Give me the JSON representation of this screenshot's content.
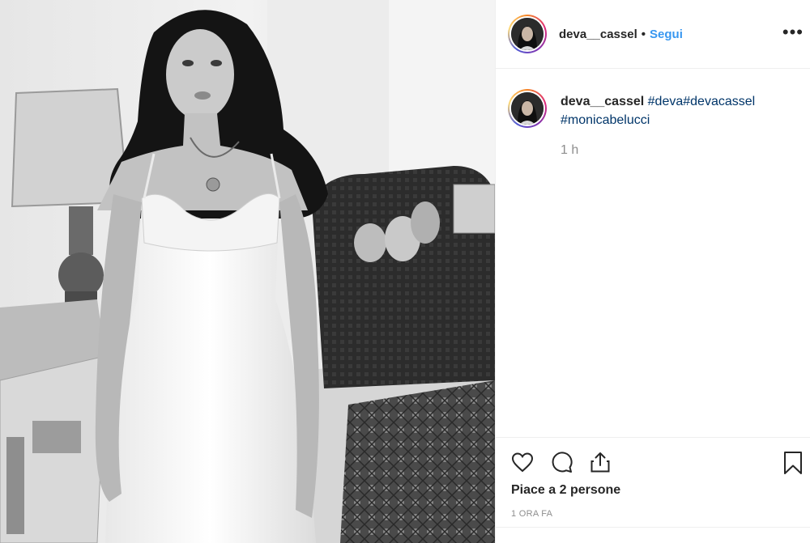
{
  "post": {
    "image_alt": "Black-and-white photo of a young woman in a white slip dress standing in a room with a lamp, sofa and patterned rug",
    "author": {
      "username": "deva__cassel",
      "separator": "•",
      "follow_label": "Segui"
    },
    "more_icon": "more-icon",
    "more_glyph": "•••",
    "caption": {
      "username": "deva__cassel",
      "hashtags": [
        "#deva",
        "#devacassel",
        "#monicabelucci"
      ],
      "time": "1 h"
    },
    "actions": {
      "like_icon": "heart-icon",
      "comment_icon": "comment-icon",
      "share_icon": "share-icon",
      "save_icon": "bookmark-icon"
    },
    "likes_text": "Piace a 2 persone",
    "posted_ago": "1 ORA FA"
  },
  "colors": {
    "link_blue": "#3897f0",
    "hashtag_blue": "#003569",
    "muted": "#8e8e8e",
    "text": "#262626",
    "divider": "#efefef"
  }
}
